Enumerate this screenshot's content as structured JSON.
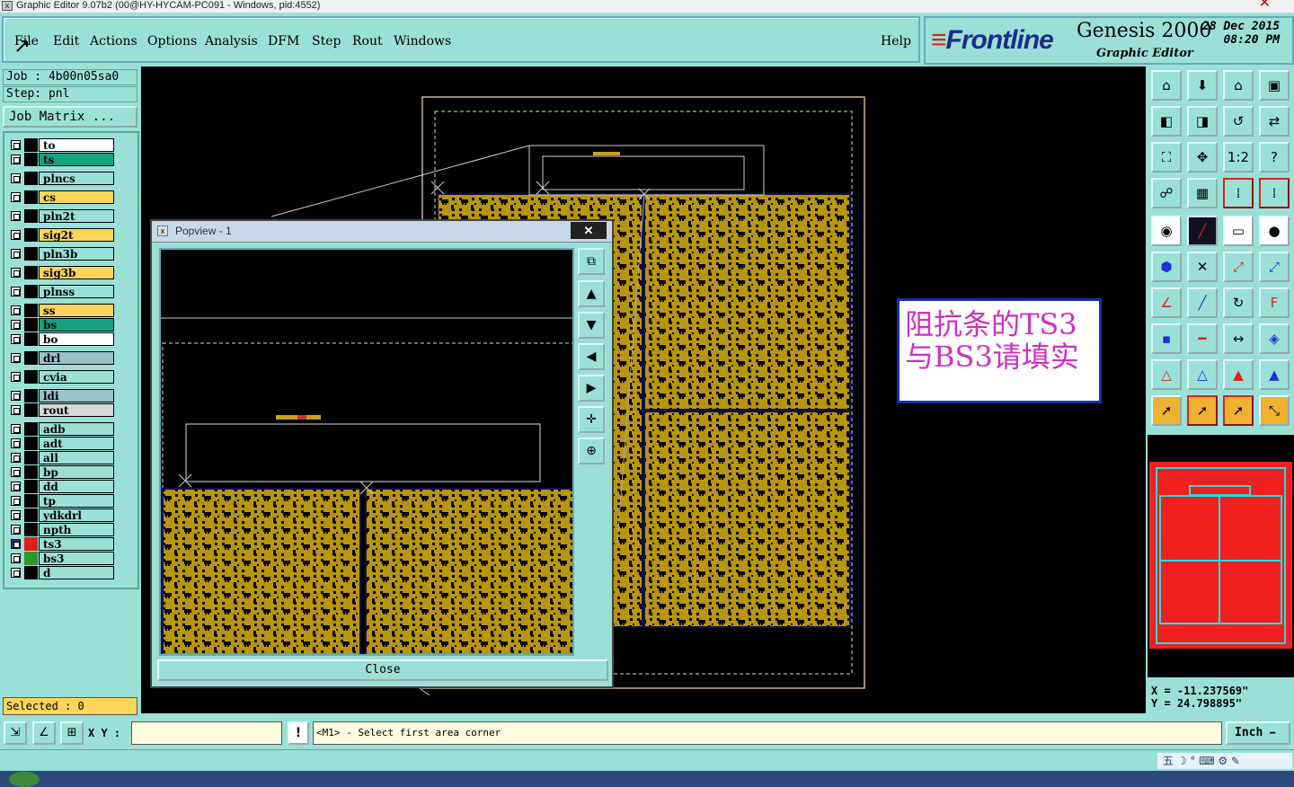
{
  "window": {
    "title": "Graphic Editor 9.07b2 (00@HY-HYCAM-PC091 - Windows, pid:4552)"
  },
  "menu": {
    "items": [
      {
        "label": "File"
      },
      {
        "label": "Edit"
      },
      {
        "label": "Actions"
      },
      {
        "label": "Options"
      },
      {
        "label": "Analysis"
      },
      {
        "label": "DFM"
      },
      {
        "label": "Step"
      },
      {
        "label": "Rout"
      },
      {
        "label": "Windows"
      }
    ],
    "help": "Help"
  },
  "brand": {
    "logo": "Frontline",
    "product": "Genesis 2000",
    "subtitle": "Graphic Editor",
    "date": "28 Dec 2015",
    "time": "08:20 PM"
  },
  "job": {
    "job_label": "Job : 4b00n05sa0",
    "step_label": "Step: pnl",
    "matrix_button": "Job Matrix ..."
  },
  "layers": [
    {
      "name": "to",
      "color": "#ffffff"
    },
    {
      "name": "ts",
      "color": "#13a383"
    },
    {
      "name": "plncs",
      "color": "#9be0d6"
    },
    {
      "name": "cs",
      "color": "#fbd55a"
    },
    {
      "name": "pln2t",
      "color": "#9be0d6"
    },
    {
      "name": "sig2t",
      "color": "#fbd55a"
    },
    {
      "name": "pln3b",
      "color": "#9be0d6"
    },
    {
      "name": "sig3b",
      "color": "#fbd55a"
    },
    {
      "name": "plnss",
      "color": "#9be0d6"
    },
    {
      "name": "ss",
      "color": "#fbd55a"
    },
    {
      "name": "bs",
      "color": "#13a383"
    },
    {
      "name": "bo",
      "color": "#ffffff"
    },
    {
      "name": "drl",
      "color": "#9ac0c8"
    },
    {
      "name": "cvia",
      "color": "#9be0d6"
    },
    {
      "name": "ldi",
      "color": "#9ac0c8"
    },
    {
      "name": "rout",
      "color": "#d8d8d8"
    },
    {
      "name": "adb",
      "color": "#9be0d6"
    },
    {
      "name": "adt",
      "color": "#9be0d6"
    },
    {
      "name": "all",
      "color": "#9be0d6"
    },
    {
      "name": "bp",
      "color": "#9be0d6"
    },
    {
      "name": "dd",
      "color": "#9be0d6"
    },
    {
      "name": "tp",
      "color": "#9be0d6"
    },
    {
      "name": "ydkdrl",
      "color": "#9be0d6"
    },
    {
      "name": "npth",
      "color": "#9be0d6"
    },
    {
      "name": "ts3",
      "color": "#9be0d6",
      "swatch": "#e02020"
    },
    {
      "name": "bs3",
      "color": "#9be0d6",
      "swatch": "#2a9a2a"
    },
    {
      "name": "d",
      "color": "#9be0d6"
    }
  ],
  "selected": "Selected : 0",
  "popview": {
    "title": "Popview - 1",
    "close": "Close"
  },
  "annotation": {
    "line1": "阻抗条的TS3",
    "line2": "与BS3请填实"
  },
  "coords": {
    "x": "X = -11.237569\"",
    "y": "Y = 24.798895\""
  },
  "bottom": {
    "xy_label": "X Y :",
    "xy_value": "",
    "prompt": "<M1> - Select first area corner",
    "units": "Inch"
  },
  "colors": {
    "panel": "#9be0d6",
    "copper": "#b8960c",
    "accent": "#fbd55a"
  }
}
